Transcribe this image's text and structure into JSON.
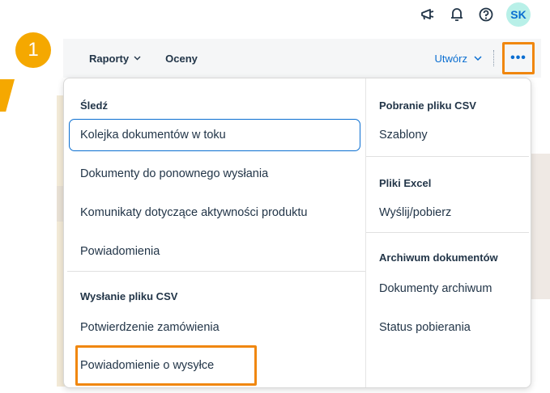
{
  "shell": {
    "avatar_initials": "SK",
    "icons": [
      "megaphone-icon",
      "bell-icon",
      "help-icon"
    ]
  },
  "callout": {
    "number": "1",
    "color": "#f5a800"
  },
  "toolbar": {
    "tab_reports": "Raporty",
    "tab_ratings": "Oceny",
    "create_label": "Utwórz",
    "more_label": "•••",
    "highlight_color": "#f0870f"
  },
  "menu": {
    "left": {
      "track_title": "Śledź",
      "track_items": [
        "Kolejka dokumentów w toku",
        "Dokumenty do ponownego wysłania",
        "Komunikaty dotyczące aktywności produktu",
        "Powiadomienia"
      ],
      "csv_upload_title": "Wysłanie pliku CSV",
      "csv_upload_items": [
        "Potwierdzenie zamówienia",
        "Powiadomienie o wysyłce"
      ]
    },
    "right": {
      "csv_download_title": "Pobranie pliku CSV",
      "csv_download_items": [
        "Szablony"
      ],
      "excel_title": "Pliki Excel",
      "excel_items": [
        "Wyślij/pobierz"
      ],
      "archive_title": "Archiwum dokumentów",
      "archive_items": [
        "Dokumenty archiwum",
        "Status pobierania"
      ]
    }
  }
}
